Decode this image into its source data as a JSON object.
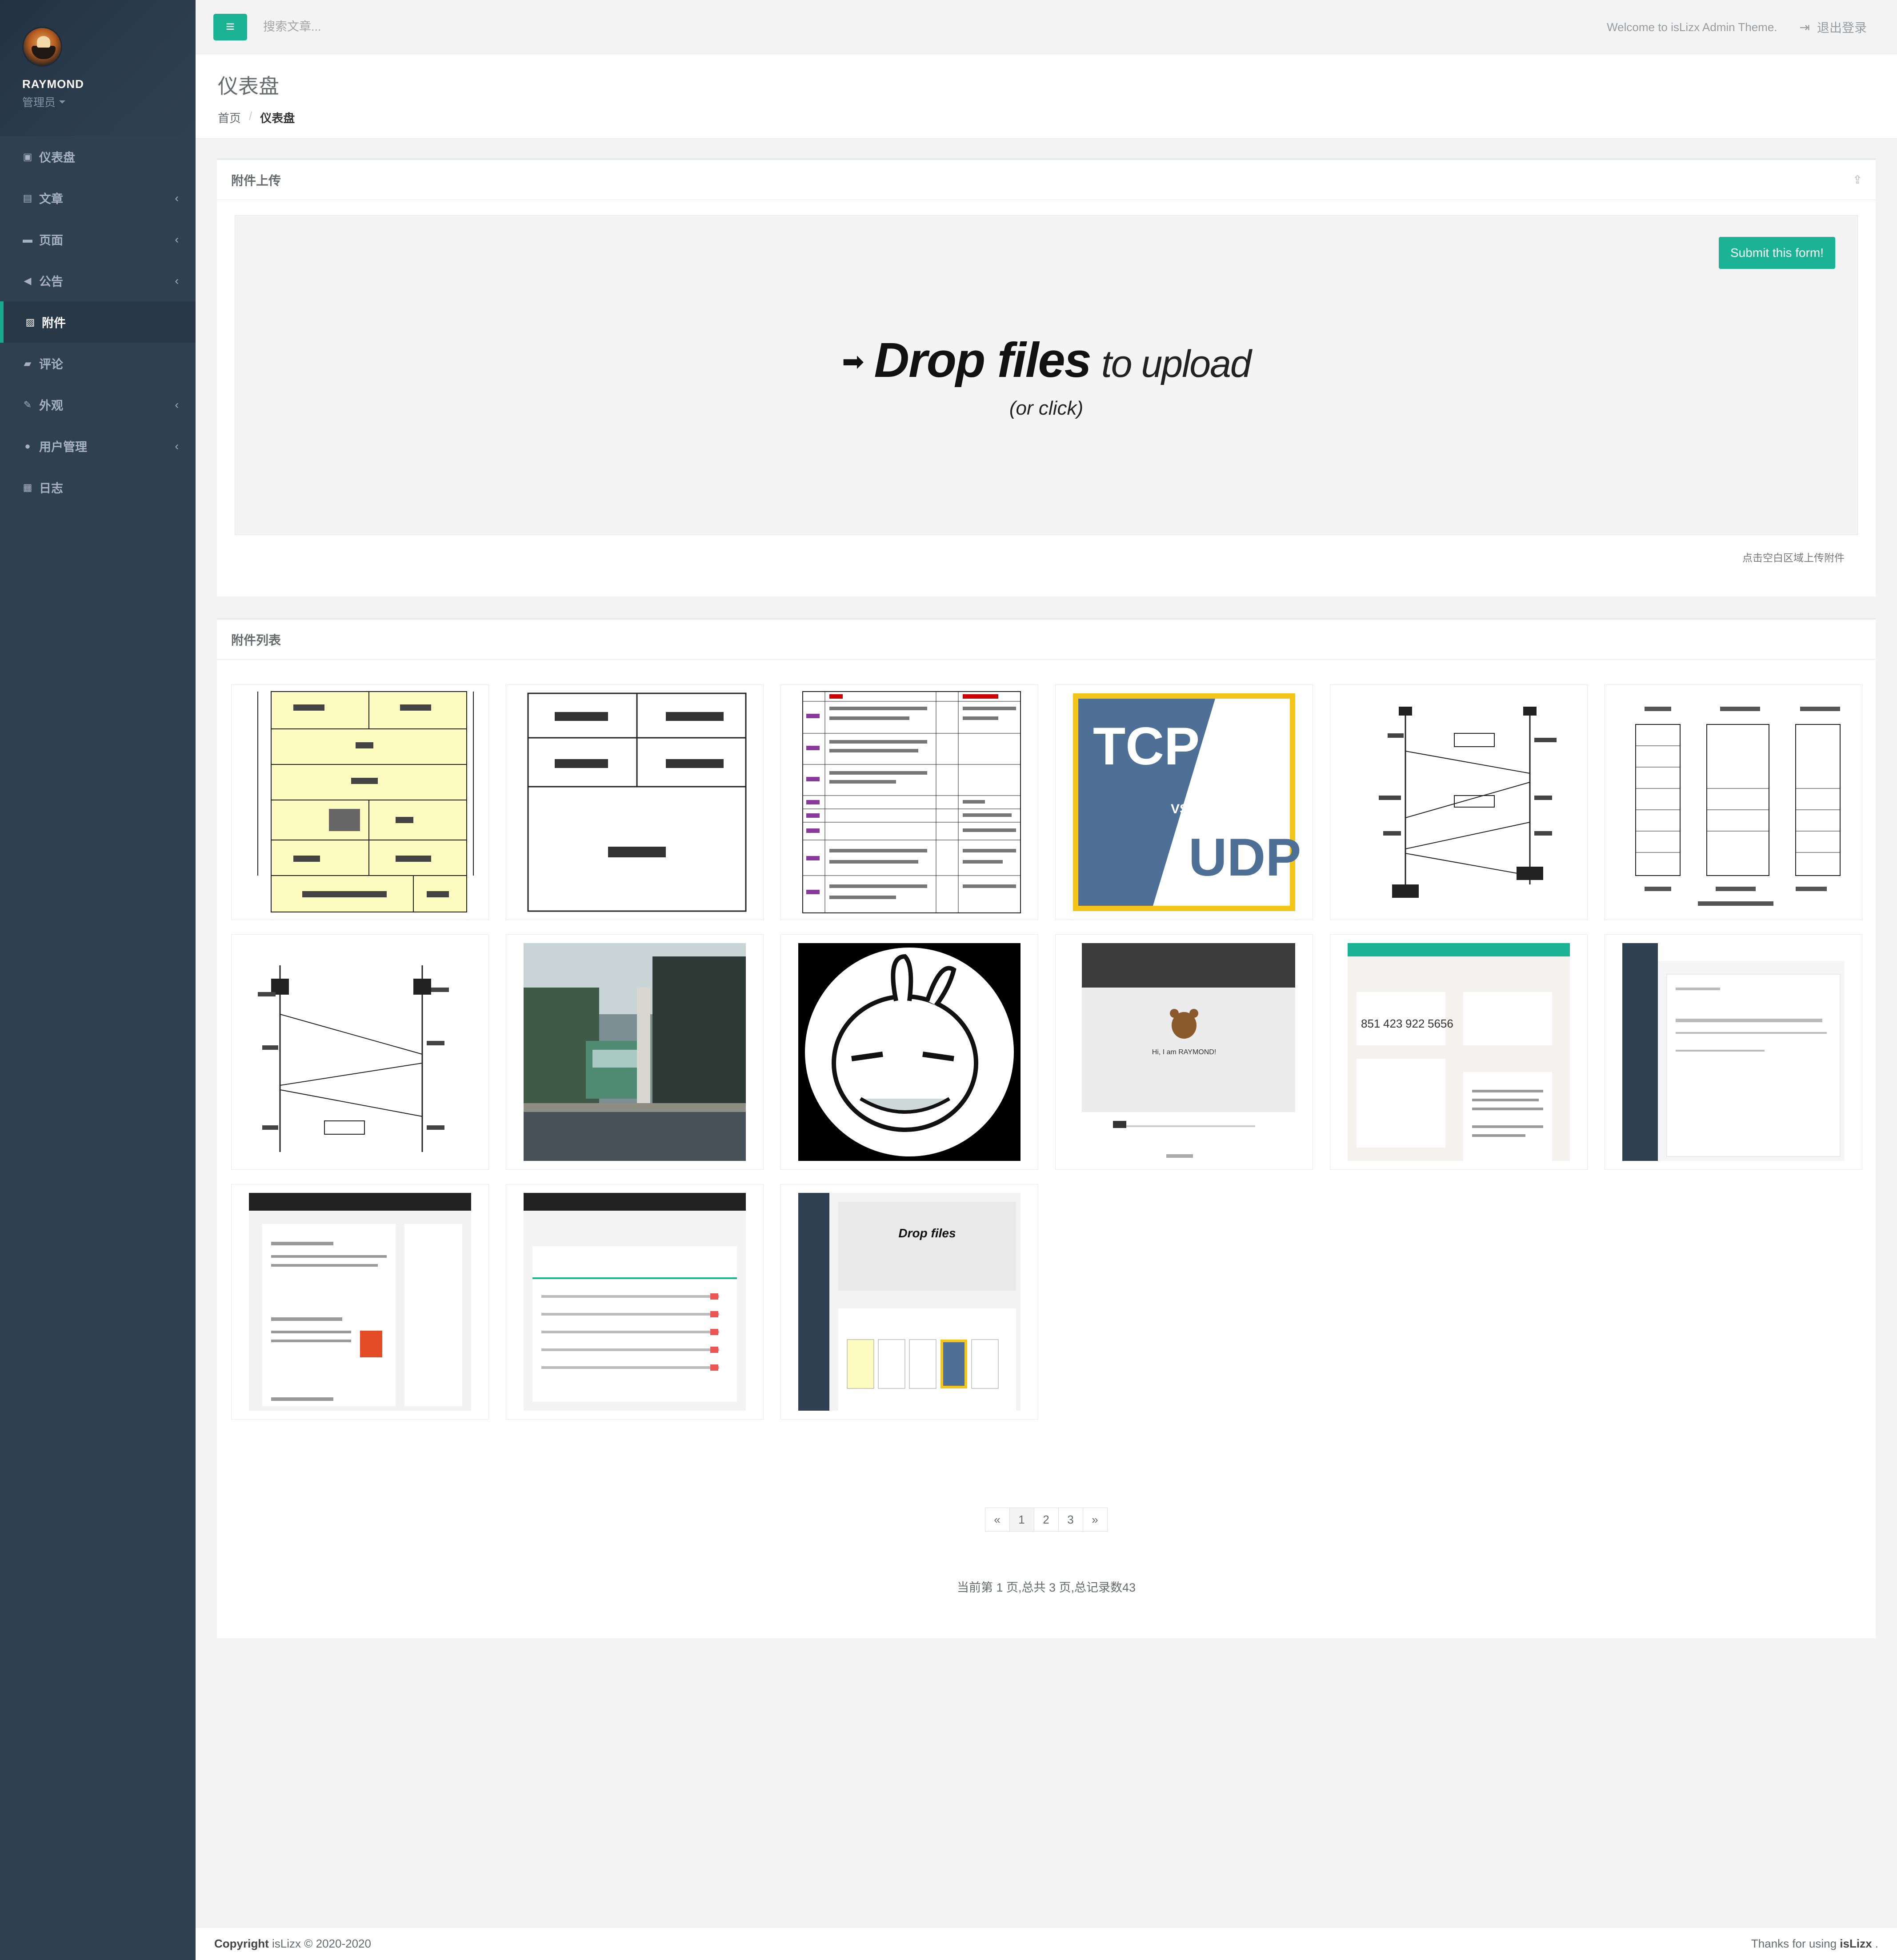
{
  "profile": {
    "name": "RAYMOND",
    "role": "管理员"
  },
  "sidebar": {
    "items": [
      {
        "label": "仪表盘",
        "icon": "dashboard-icon",
        "has_arrow": false,
        "active": false
      },
      {
        "label": "文章",
        "icon": "book-icon",
        "has_arrow": true,
        "active": false
      },
      {
        "label": "页面",
        "icon": "page-icon",
        "has_arrow": true,
        "active": false
      },
      {
        "label": "公告",
        "icon": "bullhorn-icon",
        "has_arrow": true,
        "active": false
      },
      {
        "label": "附件",
        "icon": "picture-icon",
        "has_arrow": false,
        "active": true
      },
      {
        "label": "评论",
        "icon": "comment-icon",
        "has_arrow": false,
        "active": false
      },
      {
        "label": "外观",
        "icon": "brush-icon",
        "has_arrow": true,
        "active": false
      },
      {
        "label": "用户管理",
        "icon": "user-icon",
        "has_arrow": true,
        "active": false
      },
      {
        "label": "日志",
        "icon": "save-icon",
        "has_arrow": false,
        "active": false
      }
    ],
    "arrow_glyph": "‹"
  },
  "topbar": {
    "search_placeholder": "搜索文章...",
    "welcome": "Welcome to isLizx Admin Theme.",
    "logout": "退出登录"
  },
  "heading": {
    "title": "仪表盘",
    "breadcrumb_home": "首页",
    "breadcrumb_sep": "/",
    "breadcrumb_current": "仪表盘"
  },
  "upload": {
    "title": "附件上传",
    "submit_label": "Submit this form!",
    "drop_strong": "Drop files",
    "drop_light": "to upload",
    "drop_sub": "(or click)",
    "hint": "点击空白区域上传附件"
  },
  "list": {
    "title": "附件列表",
    "thumbnails": [
      {
        "name": "tcp-header-diagram"
      },
      {
        "name": "udp-header-diagram"
      },
      {
        "name": "osi-protocol-table"
      },
      {
        "name": "tcp-vs-udp",
        "text_a": "TCP",
        "text_vs": "VS",
        "text_b": "UDP"
      },
      {
        "name": "tcp-close-handshake-diagram"
      },
      {
        "name": "network-model-comparison"
      },
      {
        "name": "tcp-open-handshake-diagram"
      },
      {
        "name": "street-photo"
      },
      {
        "name": "cartoon-rabbit-avatar"
      },
      {
        "name": "blog-homepage-screenshot",
        "caption": "Hi, I am RAYMOND!"
      },
      {
        "name": "admin-dashboard-screenshot",
        "stats": [
          "851",
          "423",
          "922",
          "5656"
        ]
      },
      {
        "name": "admin-editor-screenshot"
      },
      {
        "name": "blog-article-list-screenshot"
      },
      {
        "name": "admin-table-screenshot"
      },
      {
        "name": "admin-upload-screenshot",
        "caption": "Drop files"
      }
    ]
  },
  "pagination": {
    "prev": "«",
    "pages": [
      "1",
      "2",
      "3"
    ],
    "next": "»",
    "summary": "当前第 1 页,总共 3 页,总记录数43"
  },
  "footer": {
    "copyright_label": "Copyright",
    "copyright_text": "isLizx © 2020-2020",
    "thanks_text": "Thanks for using",
    "thanks_brand": "isLizx",
    "thanks_end": "."
  },
  "colors": {
    "sidebar": "#2f4050",
    "accent": "#1ab394",
    "background": "#f3f3f4"
  }
}
